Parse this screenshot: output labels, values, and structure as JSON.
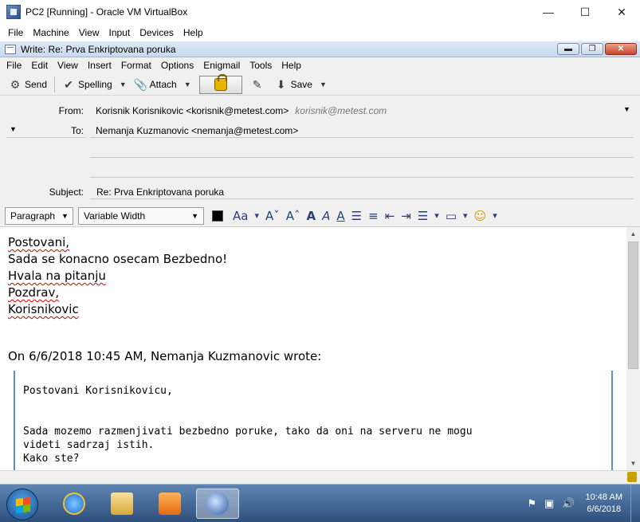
{
  "host": {
    "title": "PC2 [Running] - Oracle VM VirtualBox",
    "controls": {
      "minimize": "—",
      "maximize": "☐",
      "close": "✕"
    },
    "menu": [
      "File",
      "Machine",
      "View",
      "Input",
      "Devices",
      "Help"
    ]
  },
  "compose": {
    "title": "Write: Re: Prva Enkriptovana poruka",
    "menu": [
      "File",
      "Edit",
      "View",
      "Insert",
      "Format",
      "Options",
      "Enigmail",
      "Tools",
      "Help"
    ],
    "toolbar": {
      "send": "Send",
      "spelling": "Spelling",
      "attach": "Attach",
      "save": "Save"
    },
    "from_label": "From:",
    "from_value": "Korisnik Korisnikovic <korisnik@metest.com>",
    "from_identity": "korisnik@metest.com",
    "to_label": "To:",
    "to_value": "Nemanja Kuzmanovic <nemanja@metest.com>",
    "subject_label": "Subject:",
    "subject_value": "Re: Prva Enkriptovana poruka",
    "paragraph_format": "Paragraph",
    "font_select": "Variable Width",
    "text_color": "#000000",
    "body_lines": [
      "Postovani,",
      "Sada se konacno osecam Bezbedno!",
      "Hvala na pitanju",
      "Pozdrav,",
      "Korisnikovic"
    ],
    "quote_header": "On 6/6/2018 10:45 AM, Nemanja Kuzmanovic wrote:",
    "quote_lines": [
      "Postovani Korisnikovicu,",
      "Sada mozemo razmenjivati bezbedno poruke, tako da oni na serveru ne mogu",
      "videti sadrzaj istih.",
      "Kako ste?"
    ]
  },
  "taskbar": {
    "time": "10:48 AM",
    "date": "6/6/2018"
  }
}
